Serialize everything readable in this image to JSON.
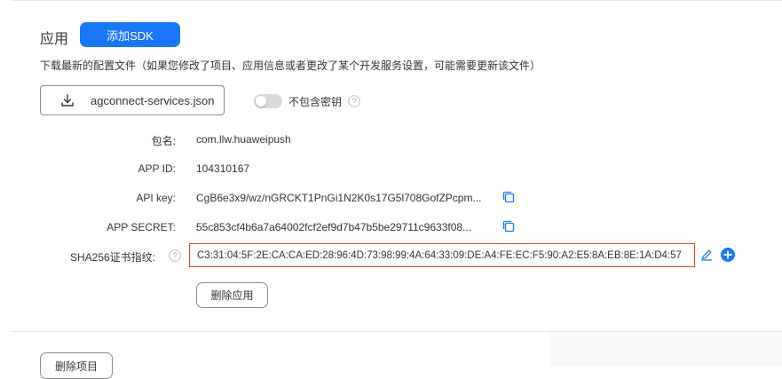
{
  "section": {
    "title": "应用",
    "add_sdk_label": "添加SDK",
    "description": "下载最新的配置文件（如果您修改了项目、应用信息或者更改了某个开发服务设置，可能需要更新该文件）"
  },
  "download": {
    "file_name": "agconnect-services.json",
    "icon": "download-icon"
  },
  "toggle": {
    "label": "不包含密钥",
    "state": "off"
  },
  "app_info": {
    "package_label": "包名:",
    "package_value": "com.llw.huaweipush",
    "app_id_label": "APP ID:",
    "app_id_value": "104310167",
    "api_key_label": "API key:",
    "api_key_value": "CgB6e3x9/wz/nGRCKT1PnGi1N2K0s17G5l708GofZPcpm...",
    "app_secret_label": "APP SECRET:",
    "app_secret_value": "55c853cf4b6a7a64002fcf2ef9d7b47b5be29711c9633f08...",
    "sha256_label": "SHA256证书指纹:",
    "sha256_value": "C3:31:04:5F:2E:CA:CA:ED:28:96:4D:73:98:99:4A:64:33:09:DE:A4:FE:EC:F5:90:A2:E5:8A:EB:8E:1A:D4:57"
  },
  "actions": {
    "delete_app_label": "删除应用",
    "delete_project_label": "删除项目"
  },
  "colors": {
    "primary": "#1677ff",
    "highlight_border": "#e53935",
    "toggle_off": "#d9d9d9"
  }
}
